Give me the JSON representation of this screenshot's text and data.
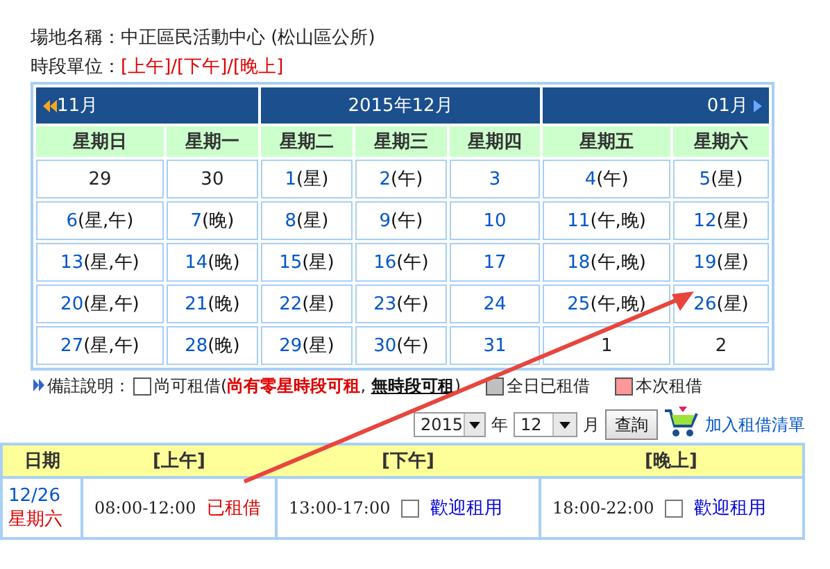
{
  "venue": {
    "label": "場地名稱：",
    "value": "中正區民活動中心 (松山區公所)"
  },
  "time_units": {
    "label": "時段單位：",
    "value": "[上午]/[下午]/[晚上]"
  },
  "calendar": {
    "prev": "11月",
    "title": "2015年12月",
    "next": "01月",
    "weekdays": [
      "星期日",
      "星期一",
      "星期二",
      "星期三",
      "星期四",
      "星期五",
      "星期六"
    ],
    "weeks": [
      [
        {
          "day": "29",
          "in_month": false
        },
        {
          "day": "30",
          "in_month": false
        },
        {
          "day": "1",
          "slots": "(星)",
          "in_month": true
        },
        {
          "day": "2",
          "slots": "(午)",
          "in_month": true
        },
        {
          "day": "3",
          "in_month": true
        },
        {
          "day": "4",
          "slots": "(午)",
          "in_month": true
        },
        {
          "day": "5",
          "slots": "(星)",
          "in_month": true
        }
      ],
      [
        {
          "day": "6",
          "slots": "(星,午)",
          "in_month": true
        },
        {
          "day": "7",
          "slots": "(晚)",
          "in_month": true
        },
        {
          "day": "8",
          "slots": "(星)",
          "in_month": true
        },
        {
          "day": "9",
          "slots": "(午)",
          "in_month": true
        },
        {
          "day": "10",
          "in_month": true
        },
        {
          "day": "11",
          "slots": "(午,晚)",
          "in_month": true
        },
        {
          "day": "12",
          "slots": "(星)",
          "in_month": true
        }
      ],
      [
        {
          "day": "13",
          "slots": "(星,午)",
          "in_month": true
        },
        {
          "day": "14",
          "slots": "(晚)",
          "in_month": true
        },
        {
          "day": "15",
          "slots": "(星)",
          "in_month": true
        },
        {
          "day": "16",
          "slots": "(午)",
          "in_month": true
        },
        {
          "day": "17",
          "in_month": true
        },
        {
          "day": "18",
          "slots": "(午,晚)",
          "in_month": true
        },
        {
          "day": "19",
          "slots": "(星)",
          "in_month": true
        }
      ],
      [
        {
          "day": "20",
          "slots": "(星,午)",
          "in_month": true
        },
        {
          "day": "21",
          "slots": "(晚)",
          "in_month": true
        },
        {
          "day": "22",
          "slots": "(星)",
          "in_month": true
        },
        {
          "day": "23",
          "slots": "(午)",
          "in_month": true
        },
        {
          "day": "24",
          "in_month": true
        },
        {
          "day": "25",
          "slots": "(午,晚)",
          "in_month": true
        },
        {
          "day": "26",
          "slots": "(星)",
          "in_month": true
        }
      ],
      [
        {
          "day": "27",
          "slots": "(星,午)",
          "in_month": true
        },
        {
          "day": "28",
          "slots": "(晚)",
          "in_month": true
        },
        {
          "day": "29",
          "slots": "(星)",
          "in_month": true
        },
        {
          "day": "30",
          "slots": "(午)",
          "in_month": true
        },
        {
          "day": "31",
          "in_month": true
        },
        {
          "day": "1",
          "in_month": false
        },
        {
          "day": "2",
          "in_month": false
        }
      ]
    ]
  },
  "legend": {
    "label": "備註說明：",
    "items": [
      {
        "color": "#ffffff",
        "text": "尚可租借(**尚有零星時段可租**, **無時段可租**)"
      },
      {
        "color": "#c0c0c0",
        "text": "全日已租借"
      },
      {
        "color": "#ff9999",
        "text": "本次租借"
      }
    ]
  },
  "query": {
    "year": "2015",
    "year_unit": "年",
    "month": "12",
    "month_unit": "月",
    "button": "查詢",
    "add_link": "加入租借清單"
  },
  "schedule": {
    "columns": [
      "日期",
      "[上午]",
      "[下午]",
      "[晚上]"
    ],
    "date": "12/26",
    "weekday": "星期六",
    "slots": [
      {
        "time": "08:00-12:00",
        "status": "已租借",
        "available": false
      },
      {
        "time": "13:00-17:00",
        "status": "歡迎租用",
        "available": true,
        "checked": false
      },
      {
        "time": "18:00-22:00",
        "status": "歡迎租用",
        "available": true,
        "checked": false
      }
    ]
  }
}
